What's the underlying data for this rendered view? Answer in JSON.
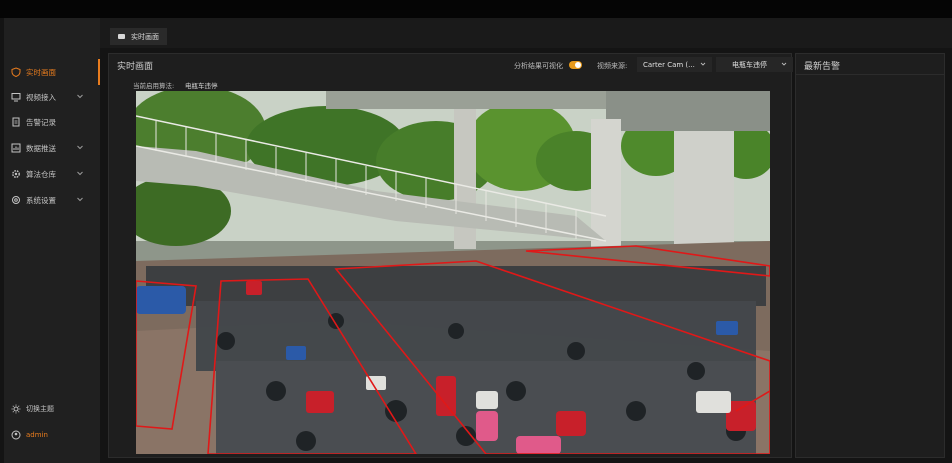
{
  "sidebar": {
    "items": [
      {
        "label": "实时画面",
        "icon": "shield-icon",
        "active": true,
        "has_arrow": false
      },
      {
        "label": "视频接入",
        "icon": "monitor-icon",
        "active": false,
        "has_arrow": true
      },
      {
        "label": "告警记录",
        "icon": "document-icon",
        "active": false,
        "has_arrow": false
      },
      {
        "label": "数据推送",
        "icon": "chart-icon",
        "active": false,
        "has_arrow": true
      },
      {
        "label": "算法仓库",
        "icon": "gear-icon",
        "active": false,
        "has_arrow": true
      },
      {
        "label": "系统设置",
        "icon": "settings-icon",
        "active": false,
        "has_arrow": true
      }
    ],
    "theme_label": "切换主题",
    "user_label": "admin"
  },
  "tabs": [
    {
      "label": "实时画面",
      "icon": "camera-icon"
    }
  ],
  "main": {
    "title": "实时画面",
    "visualize_label": "分析结果可视化",
    "visualize_on": true,
    "source_label": "视频来源:",
    "source_value": "Carter Cam (...",
    "algo_select": "电瓶车违停",
    "current_algo_label": "当前启用算法:",
    "current_algo_value": "电瓶车违停"
  },
  "alerts": {
    "title": "最新告警"
  },
  "colors": {
    "accent": "#e87c1e",
    "toggle": "#e89a1c",
    "zone_line": "#e01818"
  }
}
